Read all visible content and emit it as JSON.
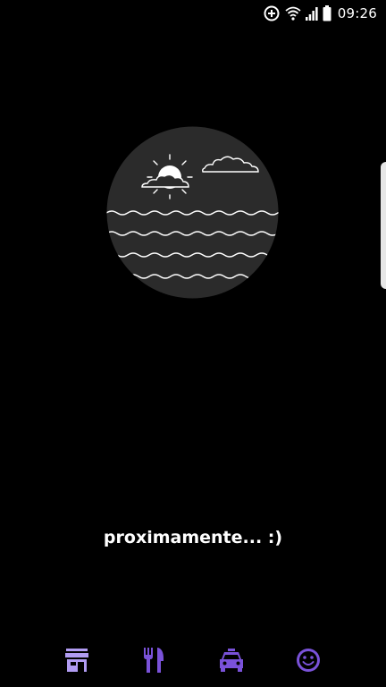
{
  "status_bar": {
    "time": "09:26",
    "icons": [
      "data-saver-icon",
      "wifi-icon",
      "signal-icon",
      "battery-icon"
    ]
  },
  "main": {
    "illustration": "sea-sun-clouds-illustration",
    "message": "proximamente... :)"
  },
  "bottom_nav": {
    "items": [
      {
        "name": "store",
        "icon": "store-icon"
      },
      {
        "name": "restaurant",
        "icon": "fork-knife-icon"
      },
      {
        "name": "taxi",
        "icon": "car-icon"
      },
      {
        "name": "smile",
        "icon": "smiley-icon"
      }
    ]
  },
  "colors": {
    "background": "#000000",
    "circle": "#2b2b2b",
    "nav_active": "#b19cf2",
    "nav_inactive": "#7a52d9"
  }
}
